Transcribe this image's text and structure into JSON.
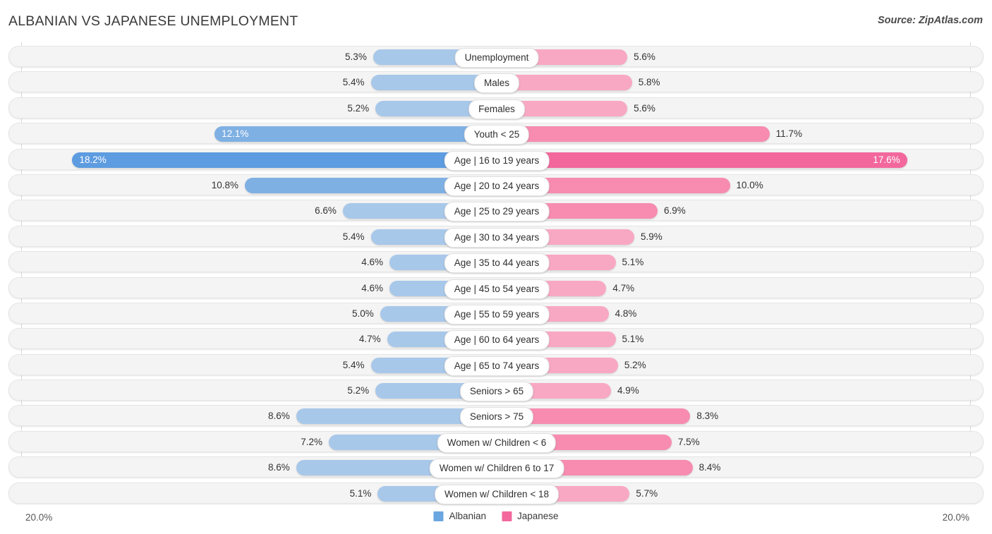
{
  "header": {
    "title": "ALBANIAN VS JAPANESE UNEMPLOYMENT",
    "source": "Source: ZipAtlas.com"
  },
  "axis": {
    "left_label": "20.0%",
    "right_label": "20.0%",
    "max": 20.0
  },
  "legend": {
    "items": [
      {
        "label": "Albanian",
        "color": "#6aa6e0"
      },
      {
        "label": "Japanese",
        "color": "#f2689c"
      }
    ]
  },
  "colors": {
    "albanian_light": "#a8c8ea",
    "albanian_mid": "#7fb0e3",
    "albanian_dark": "#5d9ce0",
    "japanese_light": "#f9a8c4",
    "japanese_mid": "#f78cb0",
    "japanese_dark": "#f2689c",
    "track": "#f4f4f4"
  },
  "chart_data": {
    "type": "bar",
    "orientation": "horizontal-diverging",
    "title": "ALBANIAN VS JAPANESE UNEMPLOYMENT",
    "xlabel": "",
    "ylabel": "",
    "xlim": [
      20.0,
      20.0
    ],
    "grid": false,
    "legend_position": "bottom-center",
    "unit": "%",
    "categories": [
      "Unemployment",
      "Males",
      "Females",
      "Youth < 25",
      "Age | 16 to 19 years",
      "Age | 20 to 24 years",
      "Age | 25 to 29 years",
      "Age | 30 to 34 years",
      "Age | 35 to 44 years",
      "Age | 45 to 54 years",
      "Age | 55 to 59 years",
      "Age | 60 to 64 years",
      "Age | 65 to 74 years",
      "Seniors > 65",
      "Seniors > 75",
      "Women w/ Children < 6",
      "Women w/ Children 6 to 17",
      "Women w/ Children < 18"
    ],
    "series": [
      {
        "name": "Albanian",
        "values": [
          5.3,
          5.4,
          5.2,
          12.1,
          18.2,
          10.8,
          6.6,
          5.4,
          4.6,
          4.6,
          5.0,
          4.7,
          5.4,
          5.2,
          8.6,
          7.2,
          8.6,
          5.1
        ]
      },
      {
        "name": "Japanese",
        "values": [
          5.6,
          5.8,
          5.6,
          11.7,
          17.6,
          10.0,
          6.9,
          5.9,
          5.1,
          4.7,
          4.8,
          5.1,
          5.2,
          4.9,
          8.3,
          7.5,
          8.4,
          5.7
        ]
      }
    ]
  },
  "rows": [
    {
      "label": "Unemployment",
      "left": "5.3%",
      "right": "5.6%",
      "left_val": 5.3,
      "right_val": 5.6,
      "left_color": "#a8c8ea",
      "right_color": "#f9a8c4",
      "inside": false
    },
    {
      "label": "Males",
      "left": "5.4%",
      "right": "5.8%",
      "left_val": 5.4,
      "right_val": 5.8,
      "left_color": "#a8c8ea",
      "right_color": "#f9a8c4",
      "inside": false
    },
    {
      "label": "Females",
      "left": "5.2%",
      "right": "5.6%",
      "left_val": 5.2,
      "right_val": 5.6,
      "left_color": "#a8c8ea",
      "right_color": "#f9a8c4",
      "inside": false
    },
    {
      "label": "Youth < 25",
      "left": "12.1%",
      "right": "11.7%",
      "left_val": 12.1,
      "right_val": 11.7,
      "left_color": "#7fb0e3",
      "right_color": "#f78cb0",
      "inside": "left"
    },
    {
      "label": "Age | 16 to 19 years",
      "left": "18.2%",
      "right": "17.6%",
      "left_val": 18.2,
      "right_val": 17.6,
      "left_color": "#5d9ce0",
      "right_color": "#f2689c",
      "inside": "both"
    },
    {
      "label": "Age | 20 to 24 years",
      "left": "10.8%",
      "right": "10.0%",
      "left_val": 10.8,
      "right_val": 10.0,
      "left_color": "#7fb0e3",
      "right_color": "#f78cb0",
      "inside": false
    },
    {
      "label": "Age | 25 to 29 years",
      "left": "6.6%",
      "right": "6.9%",
      "left_val": 6.6,
      "right_val": 6.9,
      "left_color": "#a8c8ea",
      "right_color": "#f78cb0",
      "inside": false
    },
    {
      "label": "Age | 30 to 34 years",
      "left": "5.4%",
      "right": "5.9%",
      "left_val": 5.4,
      "right_val": 5.9,
      "left_color": "#a8c8ea",
      "right_color": "#f9a8c4",
      "inside": false
    },
    {
      "label": "Age | 35 to 44 years",
      "left": "4.6%",
      "right": "5.1%",
      "left_val": 4.6,
      "right_val": 5.1,
      "left_color": "#a8c8ea",
      "right_color": "#f9a8c4",
      "inside": false
    },
    {
      "label": "Age | 45 to 54 years",
      "left": "4.6%",
      "right": "4.7%",
      "left_val": 4.6,
      "right_val": 4.7,
      "left_color": "#a8c8ea",
      "right_color": "#f9a8c4",
      "inside": false
    },
    {
      "label": "Age | 55 to 59 years",
      "left": "5.0%",
      "right": "4.8%",
      "left_val": 5.0,
      "right_val": 4.8,
      "left_color": "#a8c8ea",
      "right_color": "#f9a8c4",
      "inside": false
    },
    {
      "label": "Age | 60 to 64 years",
      "left": "4.7%",
      "right": "5.1%",
      "left_val": 4.7,
      "right_val": 5.1,
      "left_color": "#a8c8ea",
      "right_color": "#f9a8c4",
      "inside": false
    },
    {
      "label": "Age | 65 to 74 years",
      "left": "5.4%",
      "right": "5.2%",
      "left_val": 5.4,
      "right_val": 5.2,
      "left_color": "#a8c8ea",
      "right_color": "#f9a8c4",
      "inside": false
    },
    {
      "label": "Seniors > 65",
      "left": "5.2%",
      "right": "4.9%",
      "left_val": 5.2,
      "right_val": 4.9,
      "left_color": "#a8c8ea",
      "right_color": "#f9a8c4",
      "inside": false
    },
    {
      "label": "Seniors > 75",
      "left": "8.6%",
      "right": "8.3%",
      "left_val": 8.6,
      "right_val": 8.3,
      "left_color": "#a8c8ea",
      "right_color": "#f78cb0",
      "inside": false
    },
    {
      "label": "Women w/ Children < 6",
      "left": "7.2%",
      "right": "7.5%",
      "left_val": 7.2,
      "right_val": 7.5,
      "left_color": "#a8c8ea",
      "right_color": "#f78cb0",
      "inside": false
    },
    {
      "label": "Women w/ Children 6 to 17",
      "left": "8.6%",
      "right": "8.4%",
      "left_val": 8.6,
      "right_val": 8.4,
      "left_color": "#a8c8ea",
      "right_color": "#f78cb0",
      "inside": false
    },
    {
      "label": "Women w/ Children < 18",
      "left": "5.1%",
      "right": "5.7%",
      "left_val": 5.1,
      "right_val": 5.7,
      "left_color": "#a8c8ea",
      "right_color": "#f9a8c4",
      "inside": false
    }
  ]
}
